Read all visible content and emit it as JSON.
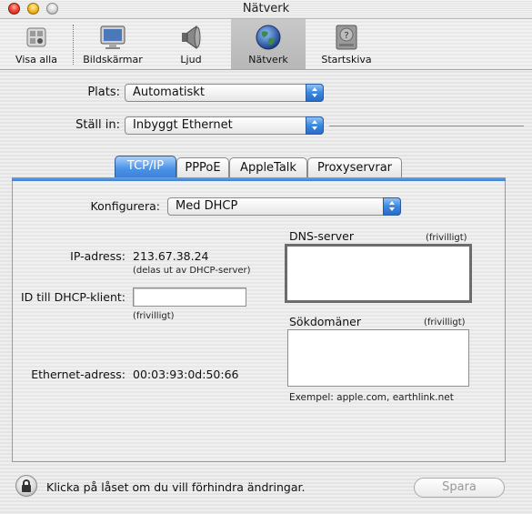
{
  "window": {
    "title": "Nätverk"
  },
  "toolbar": {
    "items": [
      {
        "label": "Visa alla",
        "icon": "apple-panel-icon"
      },
      {
        "label": "Bildskärmar",
        "icon": "monitor-icon"
      },
      {
        "label": "Ljud",
        "icon": "speaker-icon"
      },
      {
        "label": "Nätverk",
        "icon": "globe-icon"
      },
      {
        "label": "Startskiva",
        "icon": "disk-icon"
      }
    ]
  },
  "location": {
    "label": "Plats:",
    "value": "Automatiskt"
  },
  "show": {
    "label": "Ställ in:",
    "value": "Inbyggt Ethernet"
  },
  "tabs": [
    {
      "label": "TCP/IP",
      "active": true
    },
    {
      "label": "PPPoE",
      "active": false
    },
    {
      "label": "AppleTalk",
      "active": false
    },
    {
      "label": "Proxyservrar",
      "active": false
    }
  ],
  "tcpip": {
    "configure_label": "Konfigurera:",
    "configure_value": "Med DHCP",
    "ip_label": "IP-adress:",
    "ip_value": "213.67.38.24",
    "ip_note": "(delas ut av DHCP-server)",
    "client_id_label": "ID till DHCP-klient:",
    "client_id_value": "",
    "client_id_note": "(frivilligt)",
    "ethernet_label": "Ethernet-adress:",
    "ethernet_value": "00:03:93:0d:50:66",
    "dns_label": "DNS-server",
    "dns_optional": "(frivilligt)",
    "dns_value": "",
    "search_label": "Sökdomäner",
    "search_optional": "(frivilligt)",
    "search_value": "",
    "example": "Exempel: apple.com, earthlink.net"
  },
  "footer": {
    "lock_text": "Klicka på låset om du vill förhindra ändringar.",
    "save_label": "Spara"
  },
  "colors": {
    "accent": "#3a80d6"
  }
}
